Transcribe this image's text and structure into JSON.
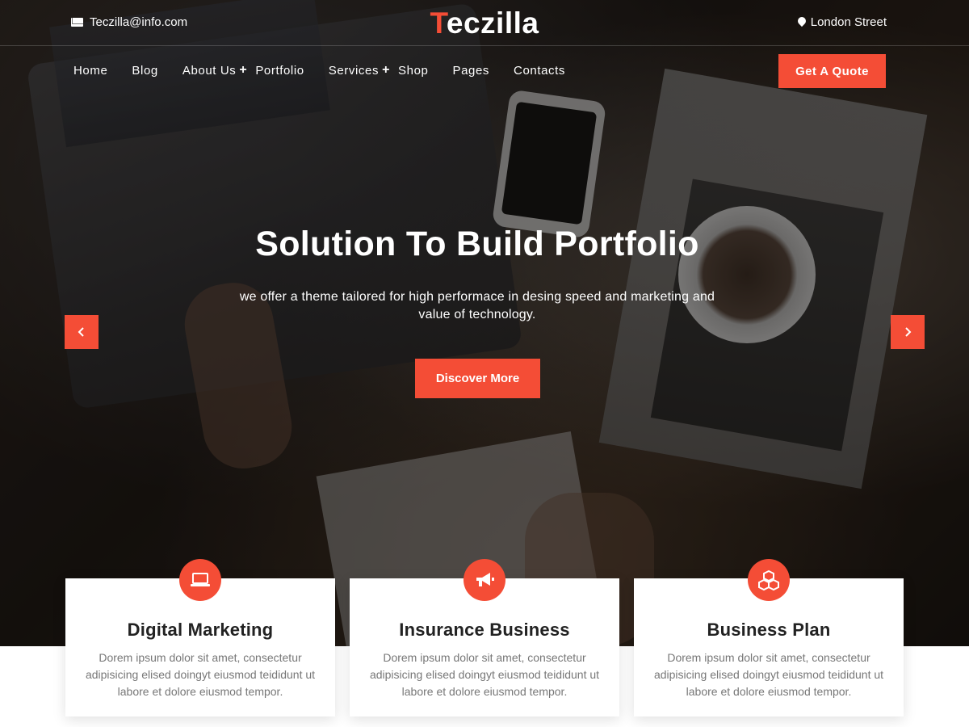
{
  "topbar": {
    "email": "Teczilla@info.com",
    "logo_first": "T",
    "logo_rest": "eczilla",
    "location": "London Street"
  },
  "nav": {
    "items": [
      {
        "label": "Home"
      },
      {
        "label": "Blog"
      },
      {
        "label": "About Us",
        "submenu_icon": "+"
      },
      {
        "label": "Portfolio"
      },
      {
        "label": "Services",
        "submenu_icon": "+"
      },
      {
        "label": "Shop"
      },
      {
        "label": "Pages"
      },
      {
        "label": "Contacts"
      }
    ],
    "cta_label": "Get A Quote"
  },
  "hero": {
    "title": "Solution To Build Portfolio",
    "subtitle": "we offer a theme tailored for high performace in desing speed and marketing and value of technology.",
    "button_label": "Discover More",
    "prev_icon": "chevron-left-icon",
    "next_icon": "chevron-right-icon"
  },
  "features": [
    {
      "icon": "laptop-icon",
      "title": "Digital Marketing",
      "text": "Dorem ipsum dolor sit amet, consectetur adipisicing elised doingyt eiusmod teididunt ut labore et dolore eiusmod tempor."
    },
    {
      "icon": "megaphone-icon",
      "title": "Insurance Business",
      "text": "Dorem ipsum dolor sit amet, consectetur adipisicing elised doingyt eiusmod teididunt ut labore et dolore eiusmod tempor."
    },
    {
      "icon": "cubes-icon",
      "title": "Business Plan",
      "text": "Dorem ipsum dolor sit amet, consectetur adipisicing elised doingyt eiusmod teididunt ut labore et dolore eiusmod tempor."
    }
  ],
  "colors": {
    "accent": "#f44d36",
    "text_dark": "#222222",
    "text_muted": "#777777"
  }
}
